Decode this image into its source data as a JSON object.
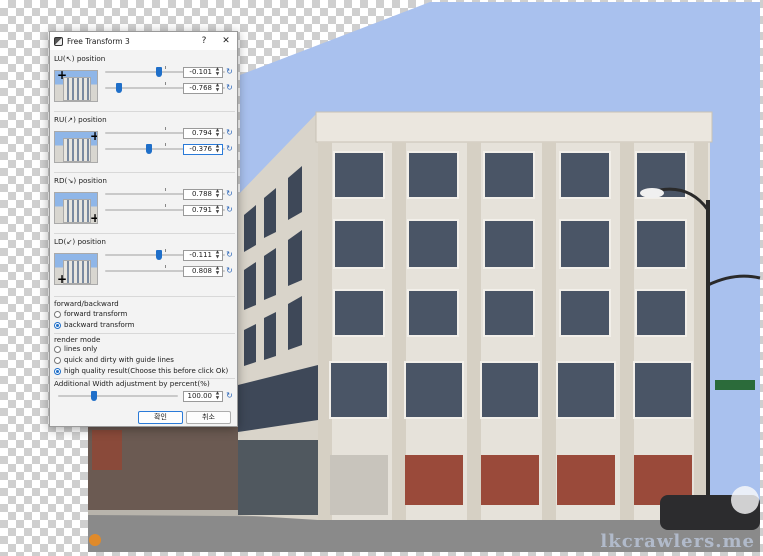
{
  "dialog": {
    "title": "Free Transform 3",
    "help_button": "?",
    "close_button": "✕",
    "corners": [
      {
        "label": "LU(↖) position",
        "x_value": "-0.101",
        "y_value": "-0.768",
        "x_slider": 0.45,
        "y_slider": 0.12
      },
      {
        "label": "RU(↗) position",
        "x_value": "0.794",
        "y_value": "-0.376",
        "x_slider": 0.75,
        "y_slider": 0.37
      },
      {
        "label": "RD(↘) position",
        "x_value": "0.788",
        "y_value": "0.791",
        "x_slider": 0.75,
        "y_slider": 0.75
      },
      {
        "label": "LD(↙) position",
        "x_value": "-0.111",
        "y_value": "0.808",
        "x_slider": 0.45,
        "y_slider": 0.76
      }
    ],
    "reset_icon": "↻",
    "spin_up": "▲",
    "spin_down": "▼",
    "forward_backward": {
      "heading": "forward/backward",
      "options": [
        "forward transform",
        "backward transform"
      ],
      "selected": "backward transform"
    },
    "render_mode": {
      "heading": "render mode",
      "options": [
        "lines only",
        "quick and dirty with guide lines",
        "high quality result(Choose this before click Ok)"
      ],
      "selected": "high quality result(Choose this before click Ok)"
    },
    "width_adjustment": {
      "label": "Additional Width adjustment by percent(%)",
      "value": "100.00",
      "slider": 0.3
    },
    "ok_button": "확인",
    "cancel_button": "취소"
  },
  "watermark": "lkcrawlers.me",
  "colors": {
    "accent": "#1f6fc9",
    "sky": "#9db8ea",
    "building": "#e4e0d8",
    "brick": "#9a4a3a"
  }
}
